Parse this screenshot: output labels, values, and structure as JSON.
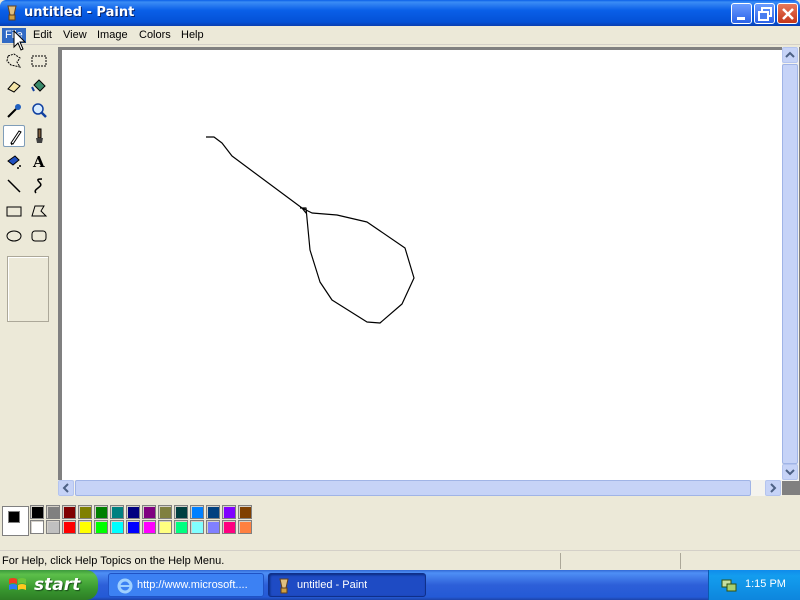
{
  "window": {
    "title": "untitled - Paint"
  },
  "menu": {
    "items": [
      "File",
      "Edit",
      "View",
      "Image",
      "Colors",
      "Help"
    ]
  },
  "toolbox": {
    "tools": [
      "free-form-select",
      "rectangle-select",
      "eraser",
      "fill-with-color",
      "pick-color",
      "magnifier",
      "pencil",
      "brush",
      "airbrush",
      "text",
      "line",
      "curve",
      "rectangle",
      "polygon",
      "ellipse",
      "rounded-rectangle"
    ],
    "selected_tool": "pencil"
  },
  "canvas": {
    "background": "#ffffff",
    "stroke_color": "#000000"
  },
  "colors": {
    "foreground": "#000000",
    "background": "#ffffff",
    "palette_row1": [
      "#000000",
      "#808080",
      "#800000",
      "#808000",
      "#008000",
      "#008080",
      "#000080",
      "#800080",
      "#808040",
      "#004040",
      "#0080ff",
      "#004080",
      "#8000ff",
      "#804000"
    ],
    "palette_row2": [
      "#ffffff",
      "#c0c0c0",
      "#ff0000",
      "#ffff00",
      "#00ff00",
      "#00ffff",
      "#0000ff",
      "#ff00ff",
      "#ffff80",
      "#00ff80",
      "#80ffff",
      "#8080ff",
      "#ff0080",
      "#ff8040"
    ]
  },
  "status": {
    "text": "For Help, click Help Topics on the Help Menu."
  },
  "taskbar": {
    "start_label": "start",
    "tasks": [
      {
        "label": "http://www.microsoft...."
      },
      {
        "label": "untitled - Paint"
      }
    ],
    "clock": "1:15 PM"
  }
}
